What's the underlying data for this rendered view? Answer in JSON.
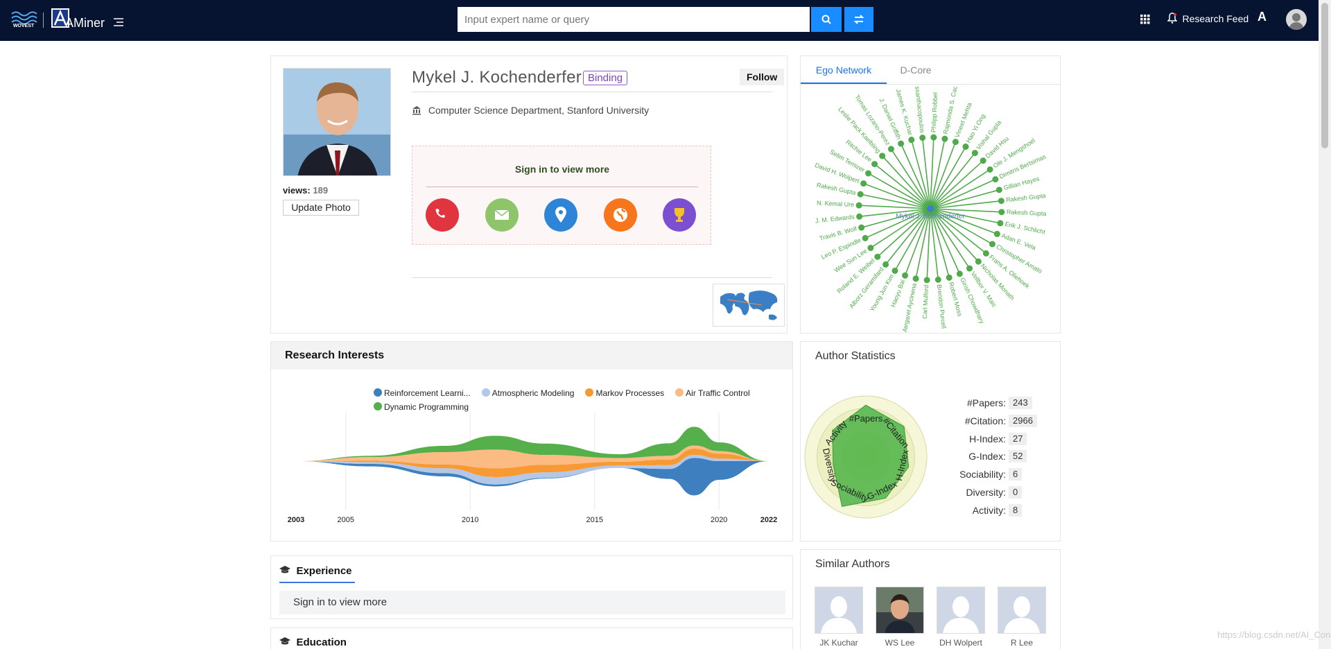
{
  "header": {
    "brand_left": "WOVEST",
    "logo": "AMiner",
    "search_placeholder": "Input expert name or query",
    "research_feed": "Research Feed",
    "lang_label": "A"
  },
  "profile": {
    "name": "Mykel J. Kochenderfer",
    "binding": "Binding",
    "follow": "Follow",
    "affiliation": "Computer Science Department, Stanford University",
    "views_label": "views:",
    "views_count": "189",
    "update_photo": "Update Photo",
    "sign_in": "Sign in to view more",
    "contact_icons": [
      {
        "name": "phone-icon",
        "color": "#e0353f"
      },
      {
        "name": "email-icon",
        "color": "#8fc56a"
      },
      {
        "name": "location-icon",
        "color": "#2e84d6"
      },
      {
        "name": "homepage-icon",
        "color": "#f7751b"
      },
      {
        "name": "award-icon",
        "color": "#7b4fd0"
      }
    ]
  },
  "ego": {
    "tabs": [
      "Ego Network",
      "D-Core"
    ],
    "center": "Mykel J. Kochenderfer",
    "nodes": [
      "Philipp Robbel",
      "Rajmonda S. Caceres",
      "Vineet Mehta",
      "Hao Yi Ong",
      "Vishal Gupta",
      "David Hsu",
      "Ole J. Mengshoel",
      "Dimitris Bertsimas",
      "Gillian Hayes",
      "Rakesh Gupta",
      "Rakesh Gupta",
      "Erik J. Schlicht",
      "Adan E. Vela",
      "Christopher Amato",
      "Frans A. Oliehoek",
      "Nicholas Monath",
      "Vellbor V. Maic",
      "Girish Chowdhary",
      "Robert Moss",
      "Brendon Purcell",
      "Carl Mulford",
      "Margaret Aycinena",
      "Haoyu Bai",
      "Young Jun Kim",
      "Alborz Geramifard",
      "Roland E. Weibel",
      "Wee Sun Lee",
      "Leo P. Espindle",
      "Travis B. Wolf",
      "J. M. Edwards",
      "N. Kemal Ure",
      "Rakesh Gupta",
      "David H. Wolpert",
      "Selim Temizer",
      "Ritchie Lee",
      "Leslie Pack Kaelbling",
      "Tomas Lozano-Perez",
      "J. Daniel Griffith",
      "James K. Kuchar",
      "P. Chryssanthacopoulos"
    ]
  },
  "research": {
    "title": "Research Interests",
    "chart_data": {
      "type": "area",
      "x": [
        2003,
        2006,
        2009,
        2011,
        2013,
        2016,
        2018,
        2019,
        2020,
        2022
      ],
      "xticks": [
        "2003",
        "2005",
        "2010",
        "2015",
        "2020",
        "2022"
      ],
      "series": [
        {
          "name": "Reinforcement Learni...",
          "color": "#3d7fbf",
          "values": [
            0,
            4,
            5,
            3,
            1,
            0,
            16,
            60,
            30,
            0
          ]
        },
        {
          "name": "Atmospheric Modeling",
          "color": "#b3c7e8",
          "values": [
            0,
            3,
            8,
            12,
            9,
            4,
            6,
            5,
            4,
            0
          ]
        },
        {
          "name": "Markov Processes",
          "color": "#f79a34",
          "values": [
            0,
            2,
            6,
            14,
            12,
            6,
            9,
            10,
            8,
            0
          ]
        },
        {
          "name": "Air Traffic Control",
          "color": "#fbbb82",
          "values": [
            0,
            6,
            20,
            30,
            16,
            6,
            6,
            5,
            4,
            0
          ]
        },
        {
          "name": "Dynamic Programming",
          "color": "#55b04c",
          "values": [
            0,
            2,
            10,
            22,
            18,
            6,
            20,
            30,
            14,
            0
          ]
        }
      ]
    }
  },
  "stats": {
    "title": "Author Statistics",
    "axes": [
      "#Papers",
      "#Citation",
      "H-Index",
      "G-Index",
      "Sociability",
      "Diversity",
      "Activity"
    ],
    "items": [
      {
        "label": "#Papers:",
        "value": "243"
      },
      {
        "label": "#Citation:",
        "value": "2966"
      },
      {
        "label": "H-Index:",
        "value": "27"
      },
      {
        "label": "G-Index:",
        "value": "52"
      },
      {
        "label": "Sociability:",
        "value": "6"
      },
      {
        "label": "Diversity:",
        "value": "0"
      },
      {
        "label": "Activity:",
        "value": "8"
      }
    ],
    "radar_values": [
      0.85,
      0.8,
      0.72,
      0.75,
      0.9,
      0.55,
      0.7
    ]
  },
  "experience": {
    "title": "Experience",
    "sign_in": "Sign in to view more"
  },
  "education": {
    "title": "Education"
  },
  "similar": {
    "title": "Similar Authors",
    "authors": [
      "JK Kuchar",
      "WS Lee",
      "DH Wolpert",
      "R Lee"
    ]
  },
  "watermark": "https://blog.csdn.net/AI_Con"
}
